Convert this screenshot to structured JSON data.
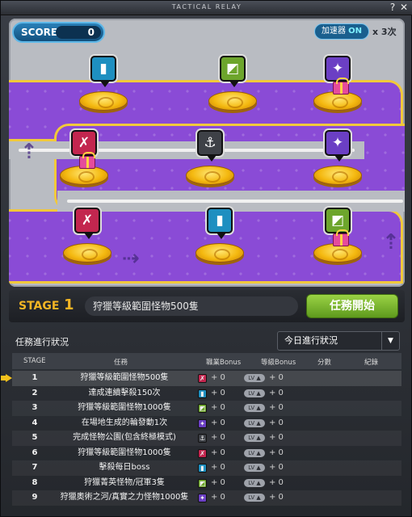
{
  "window": {
    "title": "TACTICAL RELAY",
    "help_label": "?",
    "close_label": "✕"
  },
  "score": {
    "label": "SCORE",
    "value": "0"
  },
  "accelerator": {
    "label": "加速器",
    "state": "ON",
    "multiplier": "x 3次"
  },
  "board": {
    "nodes": [
      {
        "icon": "book-icon",
        "glyph": "▮",
        "color": "#1e8fc0",
        "gift": false
      },
      {
        "icon": "crosshair-icon",
        "glyph": "◩",
        "color": "#6da52c",
        "gift": false
      },
      {
        "icon": "shuriken-icon",
        "glyph": "✦",
        "color": "#6b3fc4",
        "gift": true
      },
      {
        "icon": "sword-icon",
        "glyph": "✗",
        "color": "#c3264f",
        "gift": true
      },
      {
        "icon": "anchor-icon",
        "glyph": "⚓",
        "color": "#3e4147",
        "gift": false
      },
      {
        "icon": "shuriken-icon",
        "glyph": "✦",
        "color": "#6b3fc4",
        "gift": false
      },
      {
        "icon": "sword-icon",
        "glyph": "✗",
        "color": "#c3264f",
        "gift": false
      },
      {
        "icon": "book-icon",
        "glyph": "▮",
        "color": "#1e8fc0",
        "gift": false
      },
      {
        "icon": "crosshair-icon",
        "glyph": "◩",
        "color": "#6da52c",
        "gift": true
      }
    ]
  },
  "stage": {
    "label": "STAGE",
    "number": "1",
    "task": "狩獵等級範圍怪物500隻",
    "start_label": "任務開始"
  },
  "progress": {
    "title": "任務進行狀況",
    "filter": "今日進行狀況",
    "columns": {
      "stage": "STAGE",
      "task": "任務",
      "job_bonus": "職業Bonus",
      "level_bonus": "等級Bonus",
      "score": "分數",
      "record": "紀錄"
    },
    "rows": [
      {
        "num": "1",
        "task": "狩獵等級範圍怪物500隻",
        "icon": "sword-icon",
        "glyph": "✗",
        "color": "#c3264f",
        "job_bonus": "+ 0",
        "lv": "LV ▲",
        "level_bonus": "+ 0"
      },
      {
        "num": "2",
        "task": "達成連續擊殺150次",
        "icon": "book-icon",
        "glyph": "▮",
        "color": "#1e8fc0",
        "job_bonus": "+ 0",
        "lv": "LV ▲",
        "level_bonus": "+ 0"
      },
      {
        "num": "3",
        "task": "狩獵等級範圍怪物1000隻",
        "icon": "crosshair-icon",
        "glyph": "◩",
        "color": "#6da52c",
        "job_bonus": "+ 0",
        "lv": "LV ▲",
        "level_bonus": "+ 0"
      },
      {
        "num": "4",
        "task": "在場地生成的輪發動1次",
        "icon": "shuriken-icon",
        "glyph": "✦",
        "color": "#6b3fc4",
        "job_bonus": "+ 0",
        "lv": "LV ▲",
        "level_bonus": "+ 0"
      },
      {
        "num": "5",
        "task": "完成怪物公園(包含終極模式)",
        "icon": "anchor-icon",
        "glyph": "⚓",
        "color": "#3e4147",
        "job_bonus": "+ 0",
        "lv": "LV ▲",
        "level_bonus": "+ 0"
      },
      {
        "num": "6",
        "task": "狩獵等級範圍怪物1000隻",
        "icon": "sword-icon",
        "glyph": "✗",
        "color": "#c3264f",
        "job_bonus": "+ 0",
        "lv": "LV ▲",
        "level_bonus": "+ 0"
      },
      {
        "num": "7",
        "task": "擊殺每日boss",
        "icon": "book-icon",
        "glyph": "▮",
        "color": "#1e8fc0",
        "job_bonus": "+ 0",
        "lv": "LV ▲",
        "level_bonus": "+ 0"
      },
      {
        "num": "8",
        "task": "狩獵菁英怪物/冠軍3隻",
        "icon": "crosshair-icon",
        "glyph": "◩",
        "color": "#6da52c",
        "job_bonus": "+ 0",
        "lv": "LV ▲",
        "level_bonus": "+ 0"
      },
      {
        "num": "9",
        "task": "狩獵奧術之河/真實之力怪物1000隻",
        "icon": "shuriken-icon",
        "glyph": "✦",
        "color": "#6b3fc4",
        "job_bonus": "+ 0",
        "lv": "LV ▲",
        "level_bonus": "+ 0"
      }
    ]
  }
}
